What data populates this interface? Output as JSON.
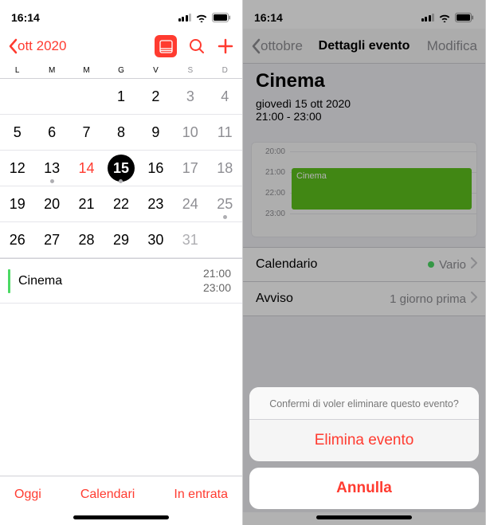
{
  "left": {
    "status_time": "16:14",
    "back_label": "ott 2020",
    "weekdays": [
      "L",
      "M",
      "M",
      "G",
      "V",
      "S",
      "D"
    ],
    "grid": [
      [
        "",
        "",
        "",
        "1",
        "2",
        "3",
        "4"
      ],
      [
        "5",
        "6",
        "7",
        "8",
        "9",
        "10",
        "11"
      ],
      [
        "12",
        "13",
        "14",
        "15",
        "16",
        "17",
        "18"
      ],
      [
        "19",
        "20",
        "21",
        "22",
        "23",
        "24",
        "25"
      ],
      [
        "26",
        "27",
        "28",
        "29",
        "30",
        "31",
        ""
      ]
    ],
    "event": {
      "title": "Cinema",
      "start": "21:00",
      "end": "23:00"
    },
    "toolbar": {
      "today": "Oggi",
      "calendars": "Calendari",
      "inbox": "In entrata"
    }
  },
  "right": {
    "status_time": "16:14",
    "back_label": "ottobre",
    "title": "Dettagli evento",
    "edit": "Modifica",
    "event_title": "Cinema",
    "event_date": "giovedì 15 ott 2020",
    "event_time": "21:00 - 23:00",
    "hours": [
      "20:00",
      "21:00",
      "22:00",
      "23:00"
    ],
    "tl_event_label": "Cinema",
    "row_calendar_label": "Calendario",
    "row_calendar_value": "Vario",
    "row_alert_label": "Avviso",
    "row_alert_value": "1 giorno prima",
    "sheet_msg": "Confermi di voler eliminare questo evento?",
    "sheet_delete": "Elimina evento",
    "sheet_cancel": "Annulla"
  }
}
